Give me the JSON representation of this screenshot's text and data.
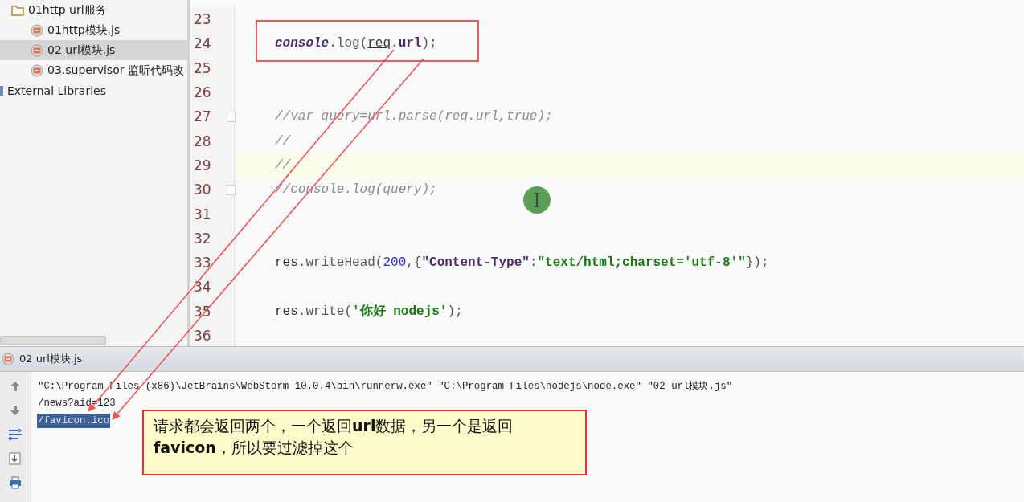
{
  "project_tree": [
    {
      "label": "01http url服务",
      "kind": "folder",
      "selected": false,
      "children": [
        {
          "label": "01http模块.js",
          "kind": "js",
          "selected": false
        },
        {
          "label": "02 url模块.js",
          "kind": "js",
          "selected": true
        },
        {
          "label": "03.supervisor 监听代码改",
          "kind": "js",
          "selected": false
        }
      ]
    },
    {
      "label": "External Libraries",
      "kind": "library",
      "selected": false
    }
  ],
  "editor": {
    "lines": [
      {
        "number": "23",
        "current": false,
        "fold": false
      },
      {
        "number": "24",
        "current": false,
        "fold": false,
        "tokens": [
          {
            "text": "console",
            "kind": "global"
          },
          {
            "text": ".log(",
            "kind": "plain"
          },
          {
            "text": "req",
            "kind": "param"
          },
          {
            "text": ".",
            "kind": "plain"
          },
          {
            "text": "url",
            "kind": "field"
          },
          {
            "text": ");",
            "kind": "plain"
          }
        ]
      },
      {
        "number": "25",
        "current": false,
        "fold": false
      },
      {
        "number": "26",
        "current": false,
        "fold": false
      },
      {
        "number": "27",
        "current": false,
        "fold": true,
        "tokens": [
          {
            "text": "//var query=url.parse(req.url,true);",
            "kind": "comment"
          }
        ]
      },
      {
        "number": "28",
        "current": false,
        "fold": false,
        "tokens": [
          {
            "text": "//",
            "kind": "comment"
          }
        ]
      },
      {
        "number": "29",
        "current": true,
        "fold": false,
        "tokens": [
          {
            "text": "//",
            "kind": "comment"
          }
        ]
      },
      {
        "number": "30",
        "current": false,
        "fold": true,
        "tokens": [
          {
            "text": "//console.log(query);",
            "kind": "comment"
          }
        ]
      },
      {
        "number": "31",
        "current": false,
        "fold": false
      },
      {
        "number": "32",
        "current": false,
        "fold": false
      },
      {
        "number": "33",
        "current": false,
        "fold": false,
        "tokens": [
          {
            "text": "res",
            "kind": "param"
          },
          {
            "text": ".writeHead(",
            "kind": "plain"
          },
          {
            "text": "200",
            "kind": "number"
          },
          {
            "text": ",{",
            "kind": "plain"
          },
          {
            "text": "\"Content-Type\"",
            "kind": "key"
          },
          {
            "text": ":",
            "kind": "plain"
          },
          {
            "text": "\"text/html;charset='utf-8'\"",
            "kind": "string"
          },
          {
            "text": "});",
            "kind": "plain"
          }
        ]
      },
      {
        "number": "34",
        "current": false,
        "fold": false
      },
      {
        "number": "35",
        "current": false,
        "fold": false,
        "tokens": [
          {
            "text": "res",
            "kind": "param"
          },
          {
            "text": ".write(",
            "kind": "plain"
          },
          {
            "text": "'你好 nodejs'",
            "kind": "string"
          },
          {
            "text": ");",
            "kind": "plain"
          }
        ]
      },
      {
        "number": "36",
        "current": false,
        "fold": false
      }
    ]
  },
  "run_panel": {
    "title": "02 url模块.js",
    "toolbar": [
      {
        "kind": "up"
      },
      {
        "kind": "down"
      },
      {
        "kind": "wrap"
      },
      {
        "kind": "export"
      },
      {
        "kind": "print"
      }
    ],
    "output": [
      {
        "text": "\"C:\\Program Files (x86)\\JetBrains\\WebStorm 10.0.4\\bin\\runnerw.exe\" \"C:\\Program Files\\nodejs\\node.exe\" \"02 url模块.js\"",
        "selected": false
      },
      {
        "text": "/news?aid=123",
        "selected": false
      },
      {
        "text": "/favicon.ico",
        "selected": true
      }
    ]
  },
  "annotation": {
    "note": "请求都会返回两个，一个返回**url**数据，另一个是返回**favicon**，所以要过滤掉这个"
  }
}
